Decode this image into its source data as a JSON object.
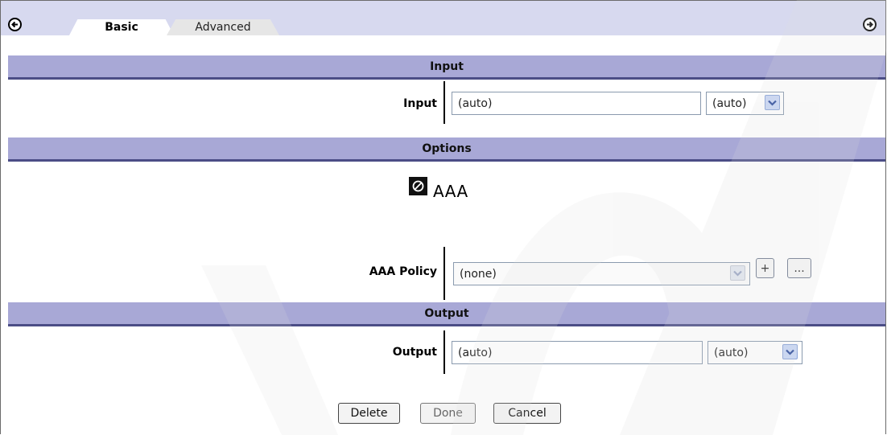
{
  "tabs": [
    {
      "label": "Basic",
      "active": true
    },
    {
      "label": "Advanced",
      "active": false
    }
  ],
  "nav": {
    "prev_icon": "circle-arrow-left-icon",
    "next_icon": "circle-arrow-right-icon"
  },
  "sections": {
    "input": {
      "header": "Input",
      "label": "Input",
      "value": "(auto)",
      "select_value": "(auto)"
    },
    "options": {
      "header": "Options",
      "action_icon": "disabled-circle-icon",
      "action_label": "AAA",
      "policy_label": "AAA Policy",
      "policy_value": "(none)",
      "add_button": "+",
      "edit_button": "..."
    },
    "output": {
      "header": "Output",
      "label": "Output",
      "value": "(auto)",
      "select_value": "(auto)"
    }
  },
  "buttons": {
    "delete": "Delete",
    "done": "Done",
    "cancel": "Cancel"
  },
  "colors": {
    "tabstrip_bg": "#d7d9ef",
    "section_header_bg": "#a8a8d6",
    "section_header_border": "#4b4d86"
  }
}
